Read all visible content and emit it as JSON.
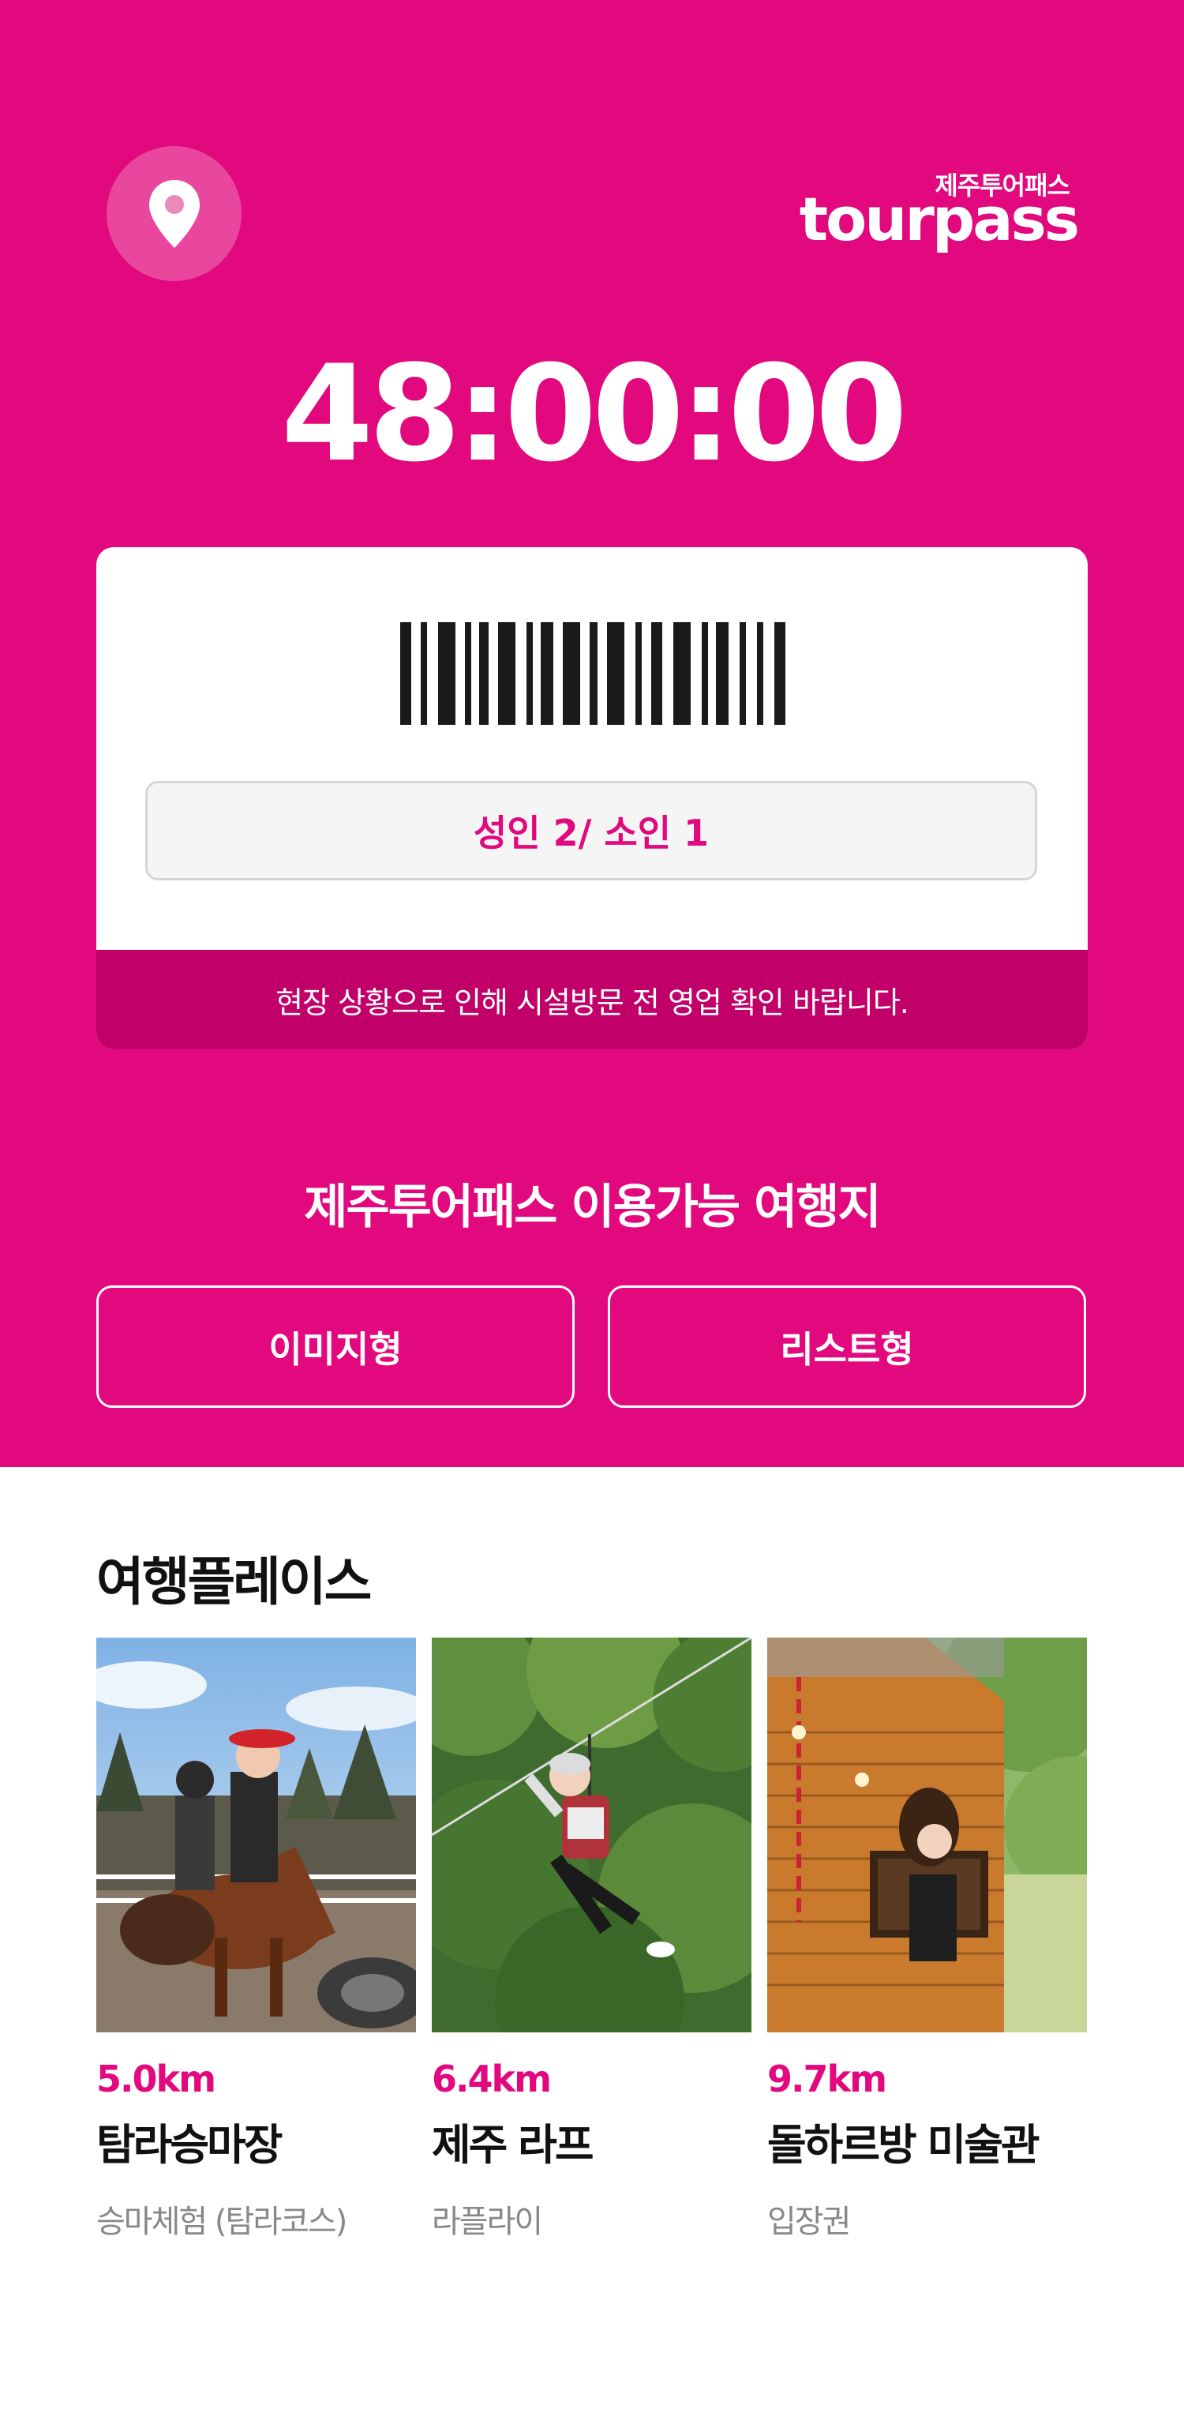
{
  "header": {
    "brand_sub": "제주투어패스",
    "brand_name": "tourpass",
    "location_icon": "location-pin-icon"
  },
  "timer": "48:00:00",
  "ticket": {
    "passengers": "성인 2/ 소인 1",
    "notice": "현장 상황으로 인해 시설방문 전 영업 확인 바랍니다."
  },
  "destinations": {
    "title": "제주투어패스 이용가능 여행지",
    "image_view_label": "이미지형",
    "list_view_label": "리스트형"
  },
  "places": {
    "title": "여행플레이스",
    "items": [
      {
        "distance": "5.0km",
        "name": "탐라승마장",
        "desc": "승마체험 (탐라코스)"
      },
      {
        "distance": "6.4km",
        "name": "제주 라프",
        "desc": "라플라이"
      },
      {
        "distance": "9.7km",
        "name": "돌하르방 미술관",
        "desc": "입장권"
      }
    ]
  },
  "colors": {
    "brand": "#e2087d",
    "notice_bg": "#c10069"
  }
}
